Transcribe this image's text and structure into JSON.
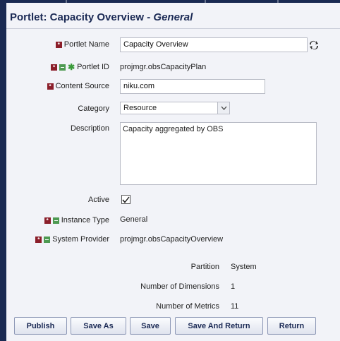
{
  "header": {
    "title": "Portlet: Capacity Overview",
    "separator": " - ",
    "subtitle": "General"
  },
  "form": {
    "portlet_name": {
      "label": "Portlet Name",
      "value": "Capacity Overview"
    },
    "portlet_id": {
      "label": "Portlet ID",
      "value": "projmgr.obsCapacityPlan"
    },
    "content_source": {
      "label": "Content Source",
      "value": "niku.com"
    },
    "category": {
      "label": "Category",
      "value": "Resource"
    },
    "description": {
      "label": "Description",
      "value": "Capacity aggregated by OBS"
    },
    "active": {
      "label": "Active",
      "checked": true
    },
    "instance_type": {
      "label": "Instance Type",
      "value": "General"
    },
    "system_provider": {
      "label": "System Provider",
      "value": "projmgr.obsCapacityOverview"
    }
  },
  "info": {
    "partition": {
      "label": "Partition",
      "value": "System"
    },
    "dimensions": {
      "label": "Number of Dimensions",
      "value": "1"
    },
    "metrics": {
      "label": "Number of Metrics",
      "value": "11"
    }
  },
  "buttons": {
    "publish": "Publish",
    "save_as": "Save As",
    "save": "Save",
    "save_and_return": "Save And Return",
    "return": "Return"
  },
  "icons": {
    "required": "required-icon",
    "locked": "locked-icon",
    "key": "key-icon",
    "refresh": "refresh-icon",
    "dropdown": "chevron-down-icon",
    "check": "checkmark-icon"
  },
  "colors": {
    "title": "#1b2a55",
    "frame": "#1a2a52",
    "required": "#8b1e2a",
    "locked": "#4e9a52",
    "background": "#f2f3f8"
  }
}
